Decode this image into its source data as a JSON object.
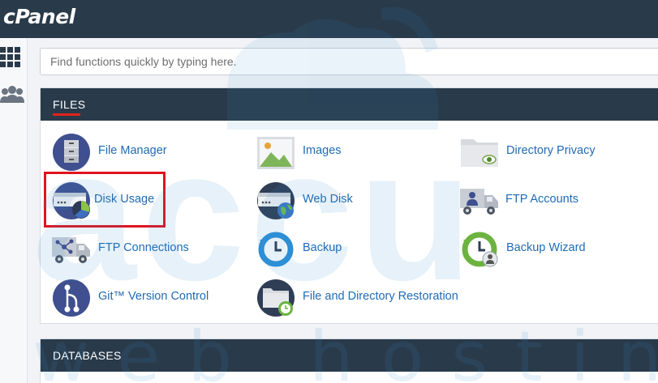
{
  "header": {
    "logo": "cPanel"
  },
  "left_nav": [
    {
      "icon": "apps-grid-icon"
    },
    {
      "icon": "users-icon"
    }
  ],
  "search": {
    "placeholder": "Find functions quickly by typing here.",
    "value": ""
  },
  "files_section": {
    "title": "FILES",
    "items": [
      {
        "label": "File Manager",
        "icon": "file-manager-icon"
      },
      {
        "label": "Images",
        "icon": "images-icon"
      },
      {
        "label": "Directory Privacy",
        "icon": "directory-privacy-icon"
      },
      {
        "label": "Disk Usage",
        "icon": "disk-usage-icon"
      },
      {
        "label": "Web Disk",
        "icon": "web-disk-icon"
      },
      {
        "label": "FTP Accounts",
        "icon": "ftp-accounts-icon"
      },
      {
        "label": "FTP Connections",
        "icon": "ftp-connections-icon"
      },
      {
        "label": "Backup",
        "icon": "backup-icon"
      },
      {
        "label": "Backup Wizard",
        "icon": "backup-wizard-icon"
      },
      {
        "label": "Git™ Version Control",
        "icon": "git-icon"
      },
      {
        "label": "File and Directory Restoration",
        "icon": "file-restoration-icon"
      }
    ]
  },
  "databases_section": {
    "title": "DATABASES"
  },
  "watermark": {
    "text": "web hosting",
    "logo": "accu"
  },
  "colors": {
    "header": "#293a4a",
    "link": "#1f6bb5",
    "highlight": "#e0141e",
    "accent": "#e2231a"
  }
}
